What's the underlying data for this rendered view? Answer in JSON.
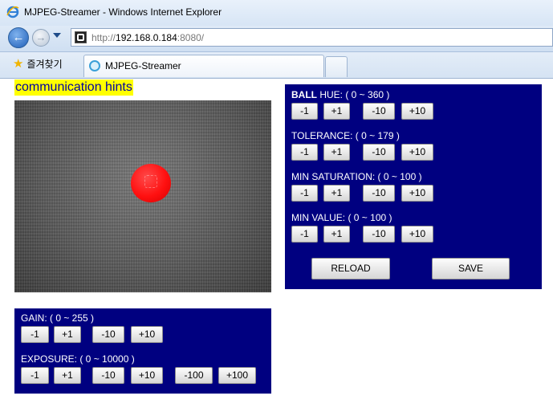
{
  "window": {
    "title": "MJPEG-Streamer - Windows Internet Explorer"
  },
  "address": {
    "scheme": "http://",
    "host": "192.168.0.184",
    "port": ":8080/"
  },
  "favorites": {
    "label": "즐겨찾기"
  },
  "tab": {
    "label": "MJPEG-Streamer"
  },
  "page": {
    "hints": "communication hints",
    "right_panel": {
      "hue_label_bold": "BALL",
      "hue_label": " HUE: ( 0 ~ 360 )",
      "tolerance_label": "TOLERANCE: ( 0 ~ 179 )",
      "min_saturation_label": "MIN SATURATION: ( 0 ~ 100 )",
      "min_value_label": "MIN VALUE: ( 0 ~ 100 )",
      "buttons": [
        "-1",
        "+1",
        "-10",
        "+10"
      ],
      "reload": "RELOAD",
      "save": "SAVE"
    },
    "left_panel": {
      "gain_label": "GAIN: ( 0 ~ 255 )",
      "exposure_label": "EXPOSURE: ( 0 ~ 10000 )",
      "gain_buttons": [
        "-1",
        "+1",
        "-10",
        "+10"
      ],
      "exposure_buttons": [
        "-1",
        "+1",
        "-10",
        "+10",
        "-100",
        "+100"
      ]
    }
  }
}
